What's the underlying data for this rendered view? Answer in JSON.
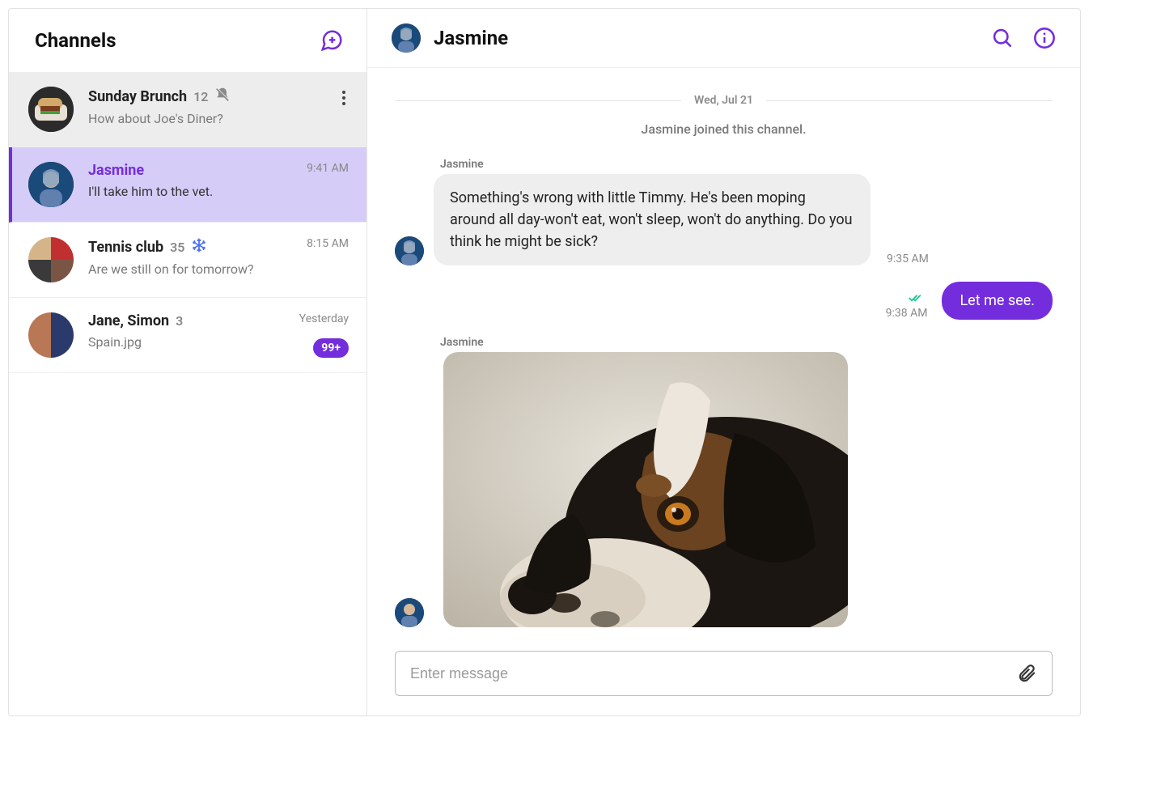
{
  "sidebar": {
    "title": "Channels",
    "channels": [
      {
        "name": "Sunday Brunch",
        "count": "12",
        "subtitle": "How about Joe's Diner?",
        "meta": "",
        "muted": true
      },
      {
        "name": "Jasmine",
        "count": "",
        "subtitle": "I'll take him to the vet.",
        "meta": "9:41 AM"
      },
      {
        "name": "Tennis club",
        "count": "35",
        "subtitle": "Are we still on for tomorrow?",
        "meta": "8:15 AM",
        "frozen": true
      },
      {
        "name": "Jane, Simon",
        "count": "3",
        "subtitle": "Spain.jpg",
        "meta": "Yesterday",
        "badge": "99+"
      }
    ]
  },
  "chat": {
    "title": "Jasmine",
    "date_label": "Wed, Jul 21",
    "system_message": "Jasmine joined this channel.",
    "messages": {
      "m1": {
        "sender": "Jasmine",
        "text": "Something's wrong with little Timmy. He's been moping around all day-won't eat, won't sleep, won't do anything. Do you think he might be sick?",
        "time": "9:35 AM"
      },
      "m2": {
        "text": "Let me see.",
        "time": "9:38 AM"
      },
      "m3": {
        "sender": "Jasmine"
      }
    },
    "input_placeholder": "Enter message"
  }
}
